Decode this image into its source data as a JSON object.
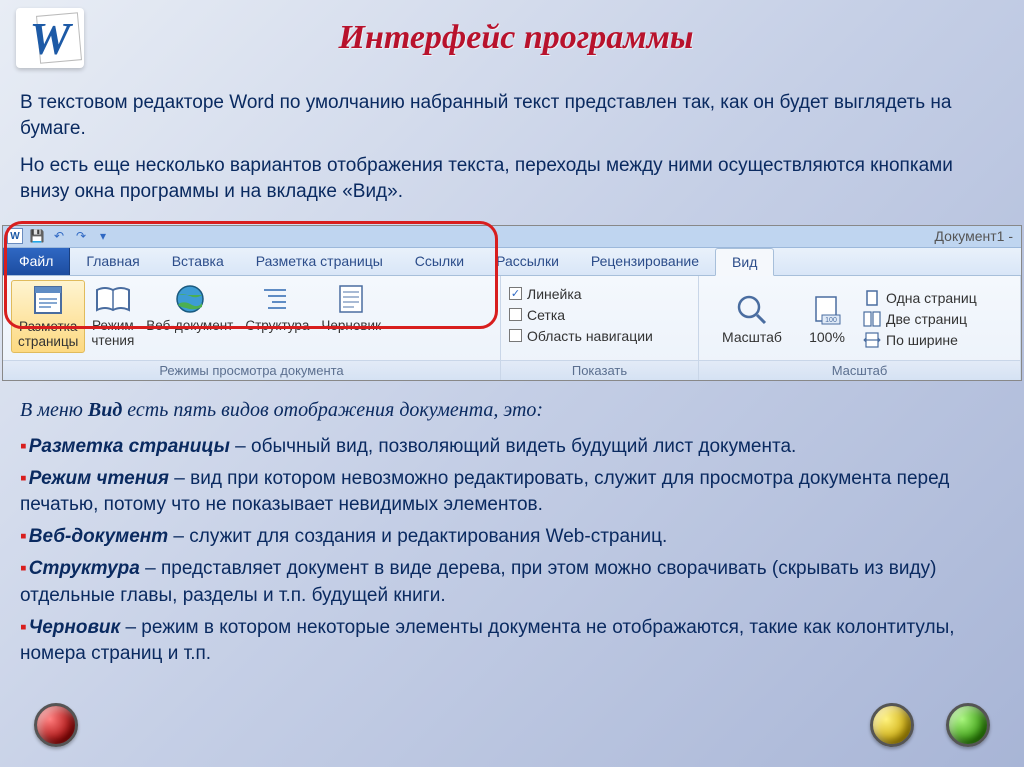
{
  "header": {
    "title": "Интерфейс программы"
  },
  "intro": {
    "p1": "В текстовом редакторе Word по умолчанию набранный текст представлен так, как он будет выглядеть на бумаге.",
    "p2": "Но есть еще несколько вариантов отображения текста, переходы между ними осуществляются кнопками внизу окна программы и на вкладке «Вид»."
  },
  "ribbon": {
    "doc_title": "Документ1 -",
    "file_tab": "Файл",
    "tabs": [
      "Главная",
      "Вставка",
      "Разметка страницы",
      "Ссылки",
      "Рассылки",
      "Рецензирование",
      "Вид"
    ],
    "group1": {
      "label": "Режимы просмотра документа",
      "items": [
        {
          "l1": "Разметка",
          "l2": "страницы"
        },
        {
          "l1": "Режим",
          "l2": "чтения"
        },
        {
          "l1": "Веб-документ",
          "l2": ""
        },
        {
          "l1": "Структура",
          "l2": ""
        },
        {
          "l1": "Черновик",
          "l2": ""
        }
      ]
    },
    "group2": {
      "label": "Показать",
      "items": [
        "Линейка",
        "Сетка",
        "Область навигации"
      ],
      "checked": [
        true,
        false,
        false
      ]
    },
    "group3": {
      "label": "Масштаб",
      "zoom": "Масштаб",
      "pct": "100%",
      "items": [
        "Одна страниц",
        "Две страниц",
        "По ширине"
      ]
    }
  },
  "explain": {
    "prefix": "В меню ",
    "bold": "Вид",
    "suffix": " есть пять видов отображения документа, это:"
  },
  "list": [
    {
      "term": "Разметка страницы",
      "text": " – обычный вид, позволяющий видеть будущий лист документа."
    },
    {
      "term": "Режим чтения",
      "text": " – вид при котором невозможно редактировать, служит для просмотра документа перед печатью, потому что не показывает невидимых элементов."
    },
    {
      "term": "Веб-документ",
      "text": " – служит для создания и редактирования Web-страниц."
    },
    {
      "term": "Структура",
      "text": " – представляет документ в виде дерева, при этом можно сворачивать (скрывать из виду) отдельные главы, разделы и т.п. будущей книги."
    },
    {
      "term": "Черновик",
      "text": " – режим в котором некоторые элементы документа не отображаются, такие как колонтитулы, номера страниц и т.п."
    }
  ]
}
